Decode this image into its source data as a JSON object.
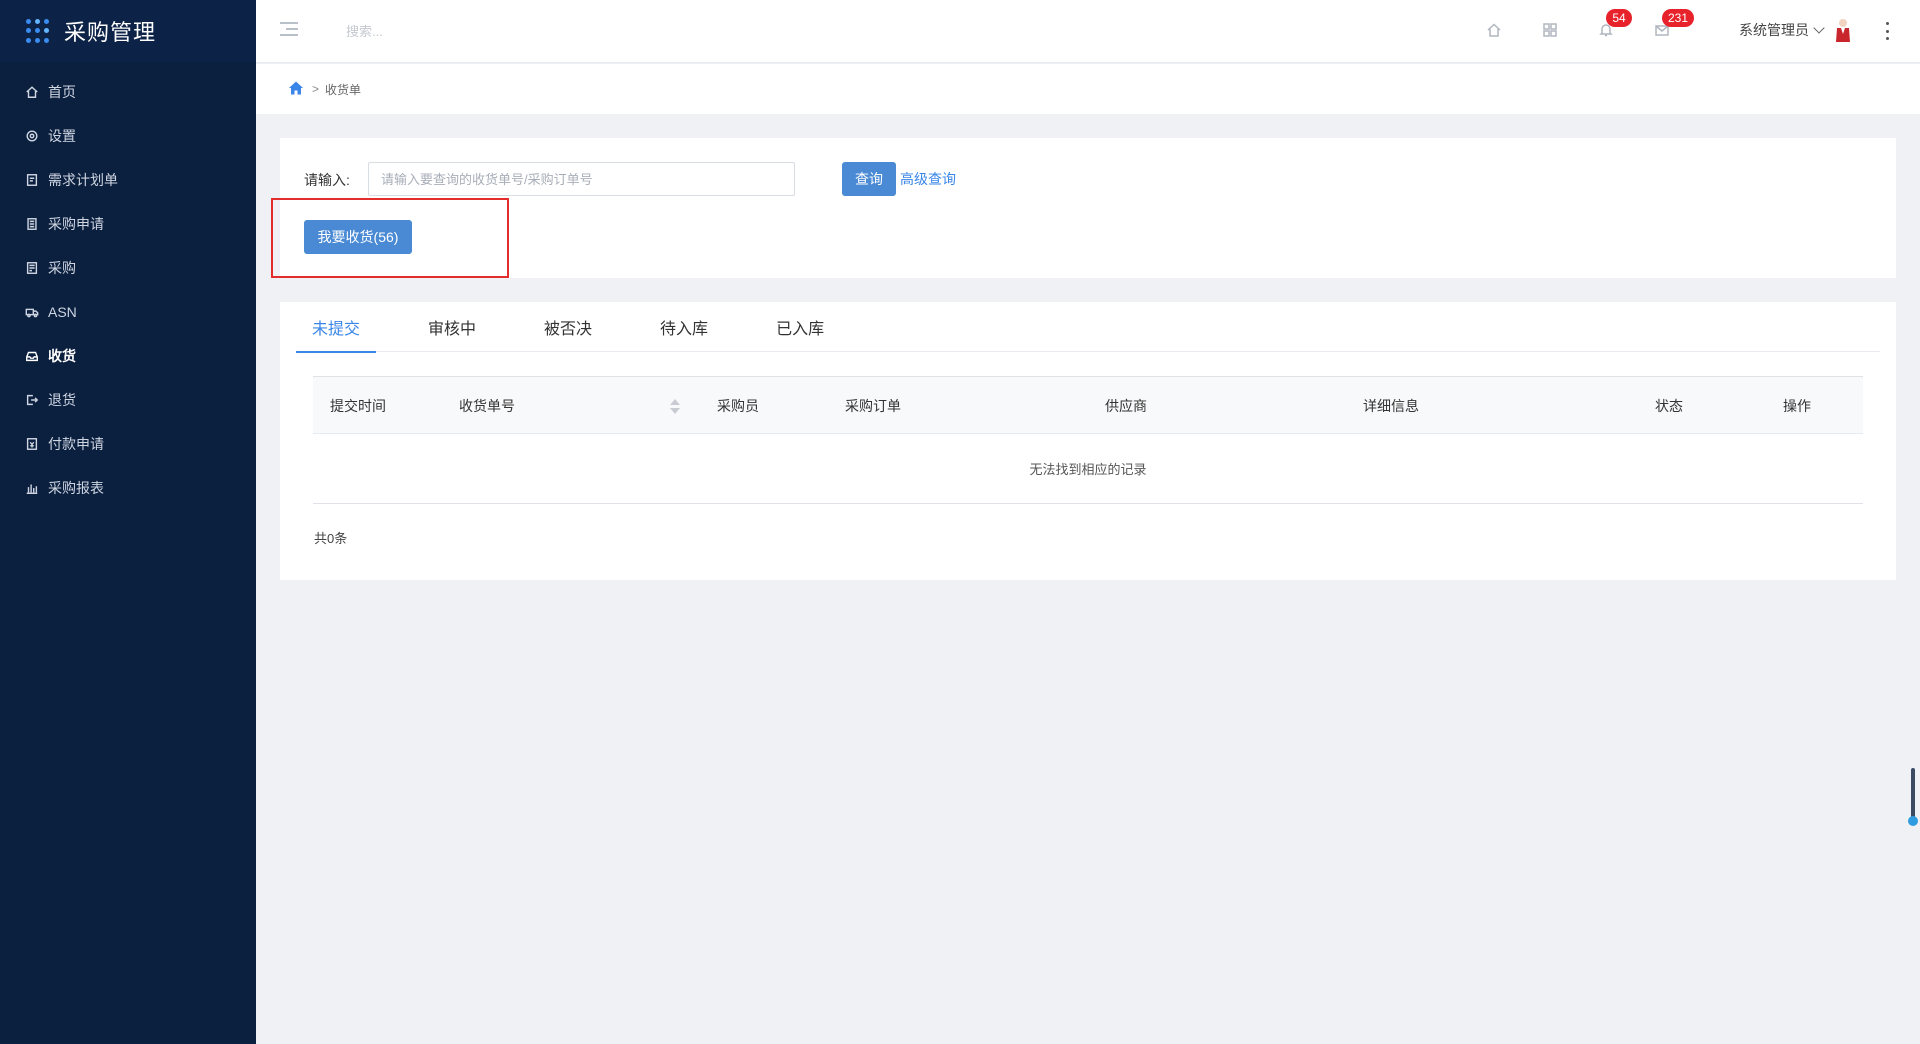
{
  "app": {
    "title": "采购管理"
  },
  "sidebar": {
    "items": [
      {
        "label": "首页",
        "icon": "home-icon"
      },
      {
        "label": "设置",
        "icon": "gear-icon"
      },
      {
        "label": "需求计划单",
        "icon": "document-icon"
      },
      {
        "label": "采购申请",
        "icon": "clipboard-icon"
      },
      {
        "label": "采购",
        "icon": "list-icon"
      },
      {
        "label": "ASN",
        "icon": "truck-icon"
      },
      {
        "label": "收货",
        "icon": "inbox-icon",
        "active": true
      },
      {
        "label": "退货",
        "icon": "return-icon"
      },
      {
        "label": "付款申请",
        "icon": "payment-icon"
      },
      {
        "label": "采购报表",
        "icon": "bar-chart-icon"
      }
    ]
  },
  "header": {
    "search_placeholder": "搜索...",
    "notifications_count": "54",
    "messages_count": "231",
    "user_name": "系统管理员"
  },
  "breadcrumb": {
    "separator": ">",
    "current": "收货单"
  },
  "search": {
    "label": "请输入:",
    "placeholder": "请输入要查询的收货单号/采购订单号",
    "value": "",
    "query_button": "查询",
    "advanced_link": "高级查询",
    "receive_button": "我要收货(56)"
  },
  "tabs": [
    {
      "label": "未提交",
      "active": true
    },
    {
      "label": "审核中"
    },
    {
      "label": "被否决"
    },
    {
      "label": "待入库"
    },
    {
      "label": "已入库"
    }
  ],
  "table": {
    "columns": [
      "提交时间",
      "收货单号",
      "采购员",
      "采购订单",
      "供应商",
      "详细信息",
      "状态",
      "操作"
    ],
    "empty_text": "无法找到相应的记录",
    "total_text": "共0条"
  },
  "colors": {
    "sidebar_bg": "#0b1f3f",
    "accent": "#3a86e8",
    "primary_button": "#4a8ad4",
    "badge": "#e8222b",
    "highlight_border": "#e32d2d"
  }
}
